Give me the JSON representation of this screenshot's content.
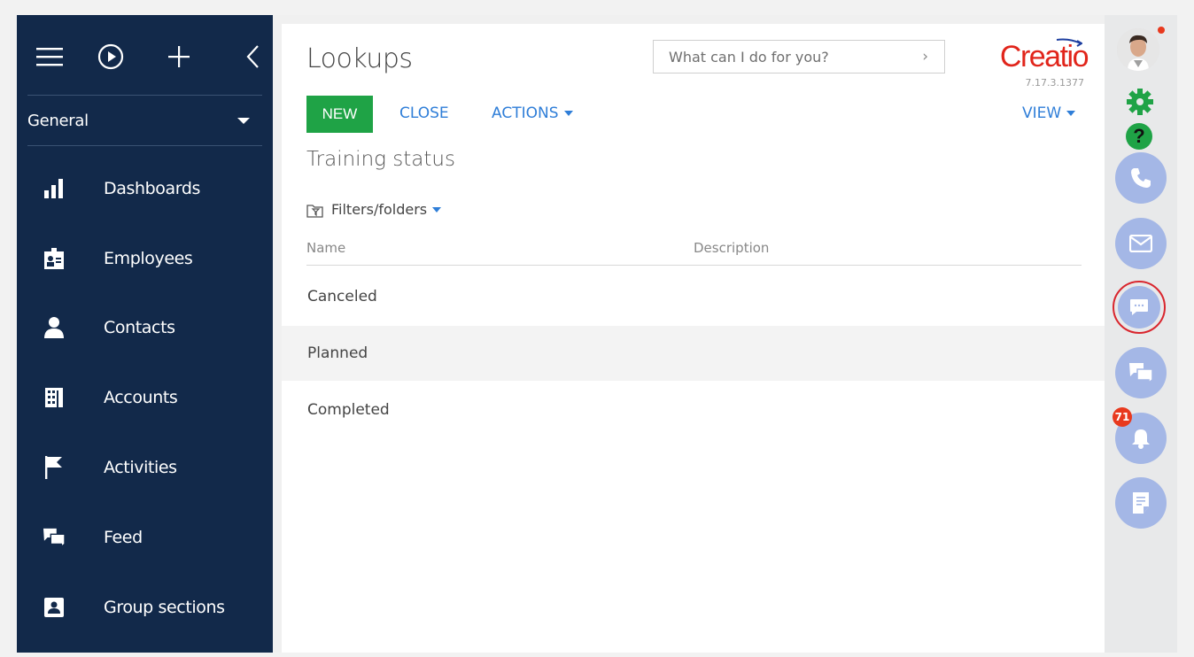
{
  "sidebar": {
    "workplace": "General",
    "items": [
      {
        "label": "Dashboards",
        "icon": "bar-chart-icon"
      },
      {
        "label": "Employees",
        "icon": "id-badge-icon"
      },
      {
        "label": "Contacts",
        "icon": "person-icon"
      },
      {
        "label": "Accounts",
        "icon": "building-icon"
      },
      {
        "label": "Activities",
        "icon": "flag-icon"
      },
      {
        "label": "Feed",
        "icon": "chat-bubbles-icon"
      },
      {
        "label": "Group sections",
        "icon": "contact-card-icon"
      }
    ]
  },
  "header": {
    "title": "Lookups",
    "search_placeholder": "What can I do for you?",
    "brand": "Creatio",
    "version": "7.17.3.1377"
  },
  "toolbar": {
    "new_label": "NEW",
    "close_label": "CLOSE",
    "actions_label": "ACTIONS",
    "view_label": "VIEW"
  },
  "lookup": {
    "name": "Training status",
    "filters_label": "Filters/folders",
    "columns": [
      "Name",
      "Description"
    ],
    "rows": [
      {
        "name": "Canceled",
        "description": "",
        "selected": false
      },
      {
        "name": "Planned",
        "description": "",
        "selected": true
      },
      {
        "name": "Completed",
        "description": "",
        "selected": false
      }
    ]
  },
  "rightbar": {
    "notification_count": "71",
    "accent": "#a4b7e6",
    "settings_color": "#1fa346",
    "help_color": "#1fa346"
  }
}
